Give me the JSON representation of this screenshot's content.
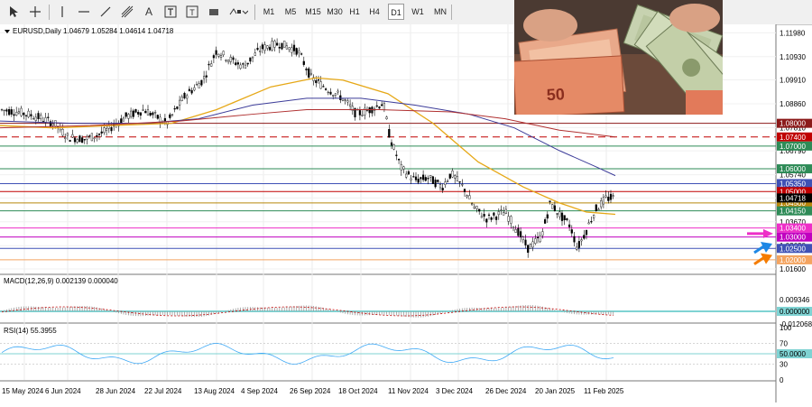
{
  "toolbar": {
    "tools": [
      "cursor-icon",
      "crosshair-icon",
      "vertical-line-icon",
      "horizontal-line-icon",
      "trendline-icon",
      "channel-icon",
      "text-icon",
      "text-label-icon",
      "rectangle-icon",
      "shapes-icon"
    ],
    "text_tool": "A",
    "label_tool": "T",
    "timeframes": [
      "M1",
      "M5",
      "M15",
      "M30",
      "H1",
      "H4",
      "D1",
      "W1",
      "MN"
    ],
    "active_timeframe": "D1"
  },
  "chart": {
    "symbol_line": "EURUSD,Daily  1.04679 1.05284 1.04614 1.04718",
    "price_axis": [
      "1.11980",
      "1.10930",
      "1.09910",
      "1.08860",
      "1.07810",
      "1.06790",
      "1.05740",
      "1.04718",
      "1.03670",
      "1.02620",
      "1.01600"
    ],
    "levels": [
      {
        "label": "1.08000",
        "color": "#8b1a1a"
      },
      {
        "label": "1.07400",
        "color": "#c00000"
      },
      {
        "label": "1.07000",
        "color": "#2e8b57"
      },
      {
        "label": "1.06000",
        "color": "#2e8b57"
      },
      {
        "label": "1.05350",
        "color": "#3f51b5"
      },
      {
        "label": "1.05000",
        "color": "#c00000"
      },
      {
        "label": "1.04500",
        "color": "#b8860b"
      },
      {
        "label": "1.04150",
        "color": "#2e8b57"
      },
      {
        "label": "1.03400",
        "color": "#ee2ec8"
      },
      {
        "label": "1.03000",
        "color": "#c000c0"
      },
      {
        "label": "1.02500",
        "color": "#3f51b5"
      },
      {
        "label": "1.02000",
        "color": "#f4a460"
      }
    ],
    "current_price": "1.04718",
    "dates": [
      "15 May 2024",
      "6 Jun 2024",
      "28 Jun 2024",
      "22 Jul 2024",
      "13 Aug 2024",
      "4 Sep 2024",
      "26 Sep 2024",
      "18 Oct 2024",
      "11 Nov 2024",
      "3 Dec 2024",
      "26 Dec 2024",
      "20 Jan 2025",
      "11 Feb 2025"
    ]
  },
  "macd": {
    "label": "MACD(12,26,9) 0.002139 0.000040",
    "axis": [
      "0.009346",
      "0.000000",
      "-0.012068"
    ]
  },
  "rsi": {
    "label": "RSI(14) 55.3955",
    "axis": [
      "100",
      "70",
      "50.0000",
      "30",
      "0"
    ]
  },
  "colors": {
    "grid": "#e6e6e6",
    "ma_fast": "#e6a817",
    "ma_mid": "#3c3c99",
    "ma_slow": "#b03030",
    "macd_signal": "#c00000",
    "rsi_line": "#3fa9f5"
  }
}
